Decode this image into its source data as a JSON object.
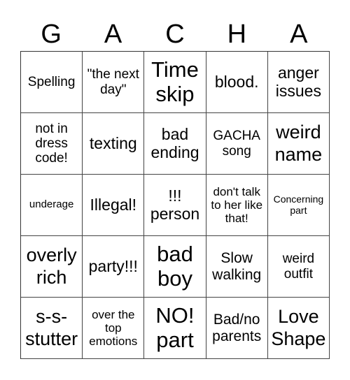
{
  "title_letters": [
    "G",
    "A",
    "C",
    "H",
    "A"
  ],
  "cells": [
    [
      "Spelling",
      "\"the next day\"",
      "Time skip",
      "blood.",
      "anger issues"
    ],
    [
      "not in dress code!",
      "texting",
      "bad ending",
      "GACHA song",
      "weird name"
    ],
    [
      "underage",
      "Illegal!",
      "!!! person",
      "don't talk to her like that!",
      "Concerning part"
    ],
    [
      "overly rich",
      "party!!!",
      "bad boy",
      "Slow walking",
      "weird outfit"
    ],
    [
      "s-s-stutter",
      "over the top emotions",
      "NO! part",
      "Bad/no parents",
      "Love Shape"
    ]
  ]
}
